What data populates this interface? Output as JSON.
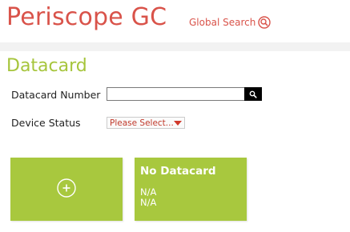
{
  "app": {
    "title": "Periscope GC",
    "global_search_label": "Global Search"
  },
  "section": {
    "title": "Datacard"
  },
  "form": {
    "datacard_number_label": "Datacard Number",
    "datacard_number_value": "",
    "device_status_label": "Device Status",
    "device_status_selected": "Please Select..."
  },
  "cards": {
    "info_title": "No Datacard",
    "info_line1": "N/A",
    "info_line2": "N/A"
  },
  "colors": {
    "brand_red": "#d9534a",
    "accent_green": "#a8c83e",
    "title_green": "#a6c53c"
  },
  "icons": {
    "global_search": "search-circle-icon",
    "datacard_search": "search-icon",
    "add_card": "plus-circle-icon",
    "status_dropdown": "caret-down-icon"
  }
}
